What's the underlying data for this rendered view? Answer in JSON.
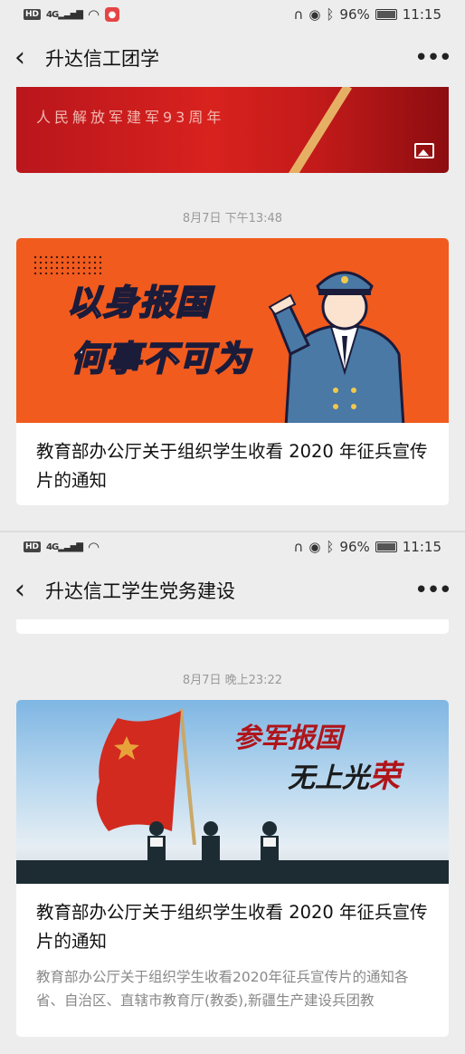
{
  "screen1": {
    "status": {
      "network": "4G",
      "battery": "96%",
      "time": "11:15"
    },
    "nav": {
      "title": "升达信工团学"
    },
    "prev_banner": {
      "subtitle": "人民解放军建军93周年"
    },
    "timestamp": "8月7日 下午13:48",
    "article": {
      "image_text_line1_a": "以身",
      "image_text_line1_b": "报国",
      "image_text_line2": "何事不可为",
      "title": "教育部办公厅关于组织学生收看  2020 年征兵宣传片的通知"
    }
  },
  "screen2": {
    "status": {
      "network": "4G",
      "battery": "96%",
      "time": "11:15"
    },
    "nav": {
      "title": "升达信工学生党务建设"
    },
    "timestamp": "8月7日 晚上23:22",
    "article": {
      "image_text_line1": "参军报国",
      "image_text_line2_a": "无上光",
      "image_text_line2_b": "荣",
      "title": "教育部办公厅关于组织学生收看 2020 年征兵宣传片的通知",
      "description": "教育部办公厅关于组织学生收看2020年征兵宣传片的通知各省、自治区、直辖市教育厅(教委),新疆生产建设兵团教"
    }
  },
  "colors": {
    "accent_orange": "#f15b1e",
    "flag_red": "#b0151a",
    "banner_red": "#c21a1a"
  },
  "icons": [
    "back-icon",
    "more-icon",
    "image-icon",
    "wifi-icon",
    "battery-icon",
    "bluetooth-icon",
    "eye-icon",
    "headphones-icon",
    "mic-icon"
  ]
}
